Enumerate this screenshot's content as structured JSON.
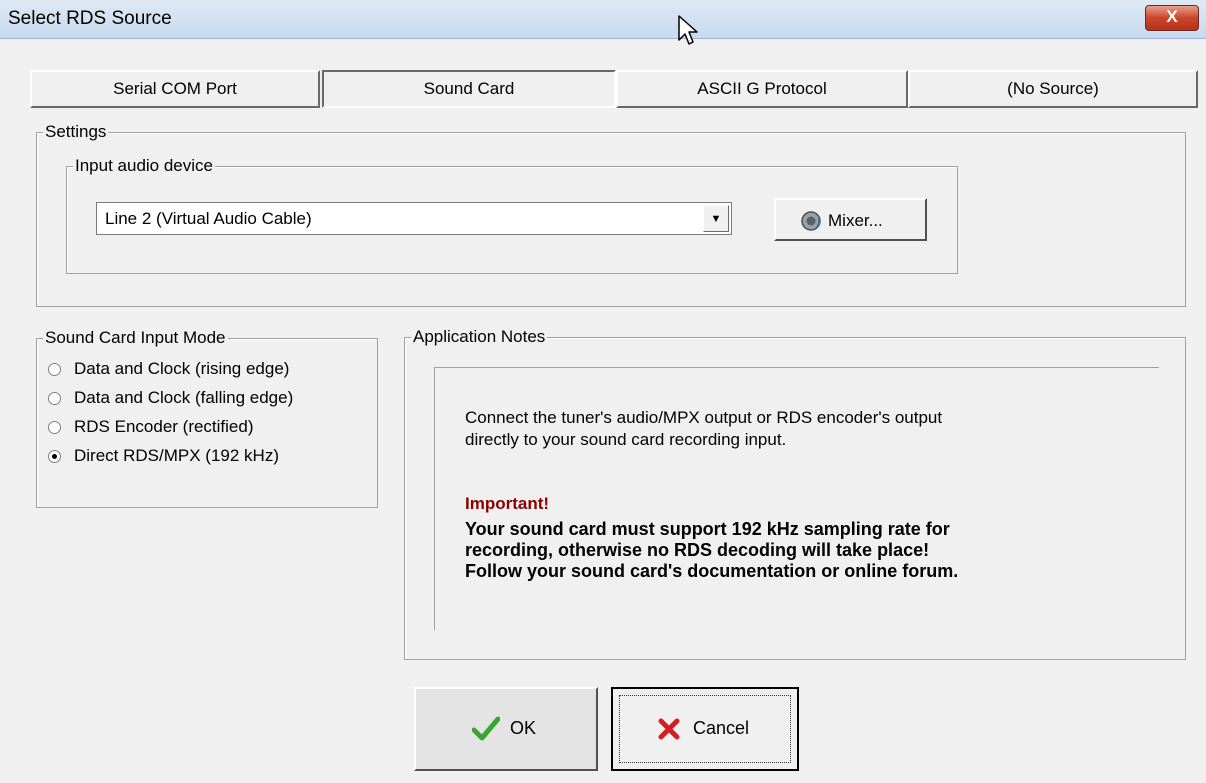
{
  "window": {
    "title": "Select RDS Source",
    "close_label": "X"
  },
  "source_tabs": [
    {
      "label": "Serial COM Port",
      "active": false
    },
    {
      "label": "Sound Card",
      "active": true
    },
    {
      "label": "ASCII G Protocol",
      "active": false
    },
    {
      "label": "(No Source)",
      "active": false
    }
  ],
  "settings": {
    "legend": "Settings",
    "input_device": {
      "legend": "Input audio device",
      "selected": "Line 2 (Virtual Audio Cable)",
      "mixer_label": "Mixer..."
    }
  },
  "input_mode": {
    "legend": "Sound Card Input Mode",
    "options": [
      {
        "label": "Data and Clock (rising edge)",
        "checked": false
      },
      {
        "label": "Data and Clock (falling edge)",
        "checked": false
      },
      {
        "label": "RDS Encoder (rectified)",
        "checked": false
      },
      {
        "label": "Direct RDS/MPX (192 kHz)",
        "checked": true
      }
    ]
  },
  "notes": {
    "legend": "Application Notes",
    "line1": "Connect the tuner's audio/MPX output or RDS encoder's output",
    "line2": "directly to your sound card recording input.",
    "important_title": "Important!",
    "important_line1": "Your sound card must support 192 kHz sampling rate for",
    "important_line2": "recording, otherwise no RDS decoding will take place!",
    "important_line3": "Follow your sound card's documentation or online forum."
  },
  "footer": {
    "ok_label": "OK",
    "cancel_label": "Cancel"
  },
  "colors": {
    "important": "#8b0000",
    "ok_check": "#3aa632",
    "cancel_x": "#d21f1f"
  }
}
